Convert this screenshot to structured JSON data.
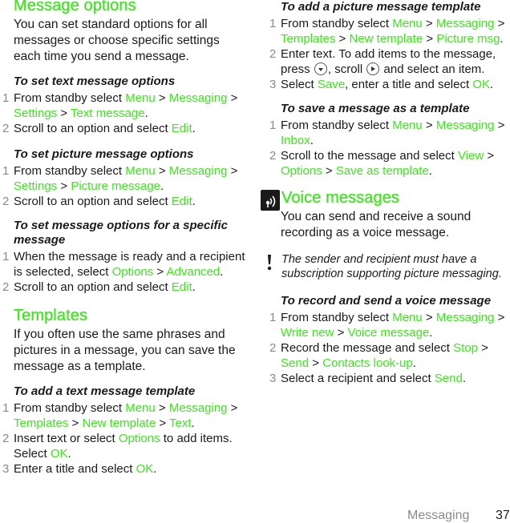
{
  "left": {
    "message_options": {
      "heading": "Message options",
      "intro": "You can set standard options for all messages or choose specific settings each time you send a message.",
      "text_options": {
        "subheading": "To set text message options",
        "steps": [
          {
            "num": "1",
            "parts": [
              "From standby select ",
              "Menu",
              " > ",
              "Messaging",
              " > ",
              "Settings",
              " > ",
              "Text message",
              "."
            ]
          },
          {
            "num": "2",
            "parts": [
              "Scroll to an option and select ",
              "Edit",
              "."
            ]
          }
        ]
      },
      "picture_options": {
        "subheading": "To set picture message options",
        "steps": [
          {
            "num": "1",
            "parts": [
              "From standby select ",
              "Menu",
              " > ",
              "Messaging",
              " > ",
              "Settings",
              " > ",
              "Picture message",
              "."
            ]
          },
          {
            "num": "2",
            "parts": [
              "Scroll to an option and select ",
              "Edit",
              "."
            ]
          }
        ]
      },
      "specific_options": {
        "subheading": "To set message options for a specific message",
        "steps": [
          {
            "num": "1",
            "parts": [
              "When the message is ready and a recipient is selected, select ",
              "Options",
              " > ",
              "Advanced",
              "."
            ]
          },
          {
            "num": "2",
            "parts": [
              "Scroll to an option and select ",
              "Edit",
              "."
            ]
          }
        ]
      }
    },
    "templates": {
      "heading": "Templates",
      "intro": "If you often use the same phrases and pictures in a message, you can save the message as a template.",
      "text_template": {
        "subheading": "To add a text message template",
        "steps": [
          {
            "num": "1",
            "parts": [
              "From standby select ",
              "Menu",
              " > ",
              "Messaging",
              " > ",
              "Templates",
              " > ",
              "New template",
              " > ",
              "Text",
              "."
            ]
          },
          {
            "num": "2",
            "parts": [
              "Insert text or select ",
              "Options",
              " to add items. Select ",
              "OK",
              "."
            ]
          },
          {
            "num": "3",
            "parts": [
              "Enter a title and select ",
              "OK",
              "."
            ]
          }
        ]
      }
    }
  },
  "right": {
    "picture_template": {
      "subheading": "To add a picture message template",
      "steps": [
        {
          "num": "1",
          "parts": [
            "From standby select ",
            "Menu",
            " > ",
            "Messaging",
            " > ",
            "Templates",
            " > ",
            "New template",
            " > ",
            "Picture msg",
            "."
          ]
        },
        {
          "num": "2",
          "parts": [
            "Enter text. To add items to the message, press ",
            "[nav-key]",
            ", scroll ",
            "[nav-right]",
            " and select an item."
          ]
        },
        {
          "num": "3",
          "parts": [
            "Select ",
            "Save",
            ", enter a title and select ",
            "OK",
            "."
          ]
        }
      ]
    },
    "save_template": {
      "subheading": "To save a message as a template",
      "steps": [
        {
          "num": "1",
          "parts": [
            "From standby select ",
            "Menu",
            " > ",
            "Messaging",
            " > ",
            "Inbox",
            "."
          ]
        },
        {
          "num": "2",
          "parts": [
            "Scroll to the message and select ",
            "View",
            " > ",
            "Options",
            " > ",
            "Save as template",
            "."
          ]
        }
      ]
    },
    "voice_messages": {
      "heading": "Voice messages",
      "icon": "voice-message-icon",
      "intro": "You can send and receive a sound recording as a voice message.",
      "note_icon": "exclamation-icon",
      "note": "The sender and recipient must have a subscription supporting picture messaging.",
      "record": {
        "subheading": "To record and send a voice message",
        "steps": [
          {
            "num": "1",
            "parts": [
              "From standby select ",
              "Menu",
              " > ",
              "Messaging",
              " > ",
              "Write new",
              " > ",
              "Voice message",
              "."
            ]
          },
          {
            "num": "2",
            "parts": [
              "Record the message and select ",
              "Stop",
              " > ",
              "Send",
              " > ",
              "Contacts look-up",
              "."
            ]
          },
          {
            "num": "3",
            "parts": [
              "Select a recipient and select ",
              "Send",
              "."
            ]
          }
        ]
      }
    }
  },
  "footer": {
    "section": "Messaging",
    "page_number": "37"
  },
  "colors": {
    "highlight": "#3ee61e",
    "step_number": "#8a8a8a",
    "text": "#1a1a1a"
  }
}
